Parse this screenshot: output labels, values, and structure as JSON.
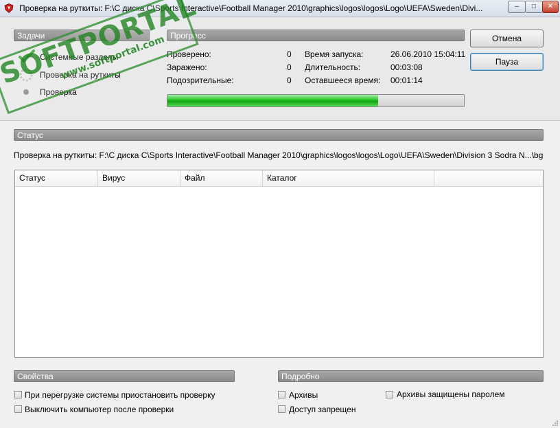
{
  "window": {
    "title": "Проверка на руткиты: F:\\C диска C\\Sports Interactive\\Football Manager 2010\\graphics\\logos\\logos\\Logo\\UEFA\\Sweden\\Divi...",
    "minimize": "–",
    "maximize": "□",
    "close": "✕"
  },
  "tasks": {
    "header": "Задачи",
    "items": [
      {
        "label": "Системные разделы",
        "status": "done"
      },
      {
        "label": "Проверка на руткиты",
        "status": "in-progress"
      },
      {
        "label": "Проверка",
        "status": "pending"
      }
    ]
  },
  "progress": {
    "header": "Прогресс",
    "checked_label": "Проверено:",
    "checked_value": "0",
    "infected_label": "Заражено:",
    "infected_value": "0",
    "suspicious_label": "Подозрительные:",
    "suspicious_value": "0",
    "start_label": "Время запуска:",
    "start_value": "26.06.2010 15:04:11",
    "duration_label": "Длительность:",
    "duration_value": "00:03:08",
    "remaining_label": "Оставшееся время:",
    "remaining_value": "00:01:14",
    "fraction": 0.71
  },
  "buttons": {
    "cancel": "Отмена",
    "pause": "Пауза"
  },
  "status": {
    "header": "Статус",
    "text": "Проверка на руткиты: F:\\C диска C\\Sports Interactive\\Football Manager 2010\\graphics\\logos\\logos\\Logo\\UEFA\\Sweden\\Division 3 Sodra N...\\bg"
  },
  "table": {
    "columns": [
      "Статус",
      "Вирус",
      "Файл",
      "Каталог"
    ],
    "rows": []
  },
  "properties": {
    "header": "Свойства",
    "options": [
      {
        "label": "При перегрузке системы приостановить проверку",
        "checked": false
      },
      {
        "label": "Выключить компьютер после проверки",
        "checked": false
      }
    ]
  },
  "details": {
    "header": "Подробно",
    "archives": "Архивы",
    "protected_archives": "Архивы защищены паролем",
    "access_denied": "Доступ запрещен"
  },
  "watermark": {
    "brand": "SOFTPORTAL",
    "url": "www.softportal.com"
  },
  "colors": {
    "progress_green": "#22c322",
    "accent_check": "#3aa63a",
    "header_gray": "#9a9a9a"
  }
}
